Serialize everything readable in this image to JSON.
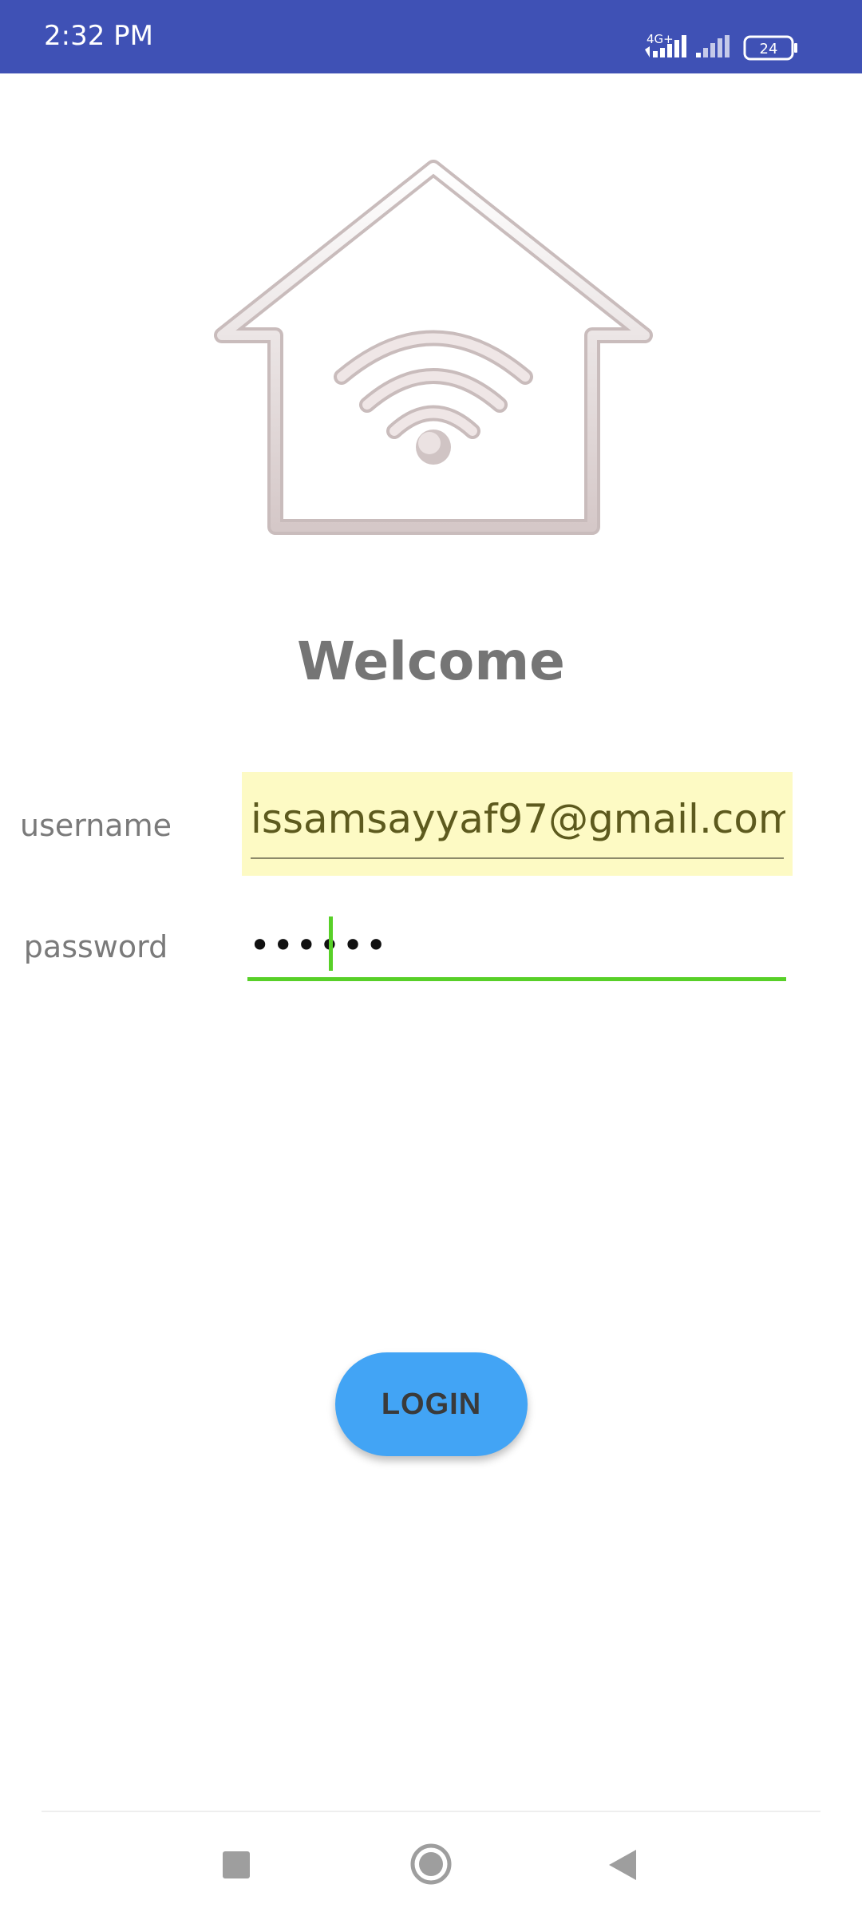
{
  "status_bar": {
    "time": "2:32 PM",
    "network_label": "4G+",
    "battery_level": "24",
    "icons": [
      "signal-icon-sim1",
      "signal-icon-sim2",
      "battery-icon"
    ]
  },
  "logo": {
    "icon": "home-wifi-icon"
  },
  "title": "Welcome",
  "form": {
    "username_label": "username",
    "username_value": "issamsayyaf97@gmail.com",
    "password_label": "password",
    "password_value": "••••••"
  },
  "login_label": "LOGIN",
  "nav_bar": {
    "icons": [
      "recents-square-icon",
      "home-circle-icon",
      "back-triangle-icon"
    ]
  },
  "colors": {
    "status_bar": "#3f51b5",
    "button": "#42a4f5",
    "focus": "#58d028",
    "autofill": "#fdfac4"
  }
}
